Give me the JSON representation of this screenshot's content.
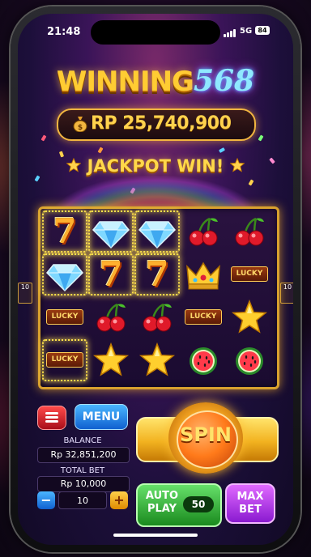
{
  "status": {
    "time": "21:48",
    "network": "5G",
    "battery": "84"
  },
  "header": {
    "logo_word": "WINNING",
    "logo_number": "568"
  },
  "jackpot_balance": "RP 25,740,900",
  "banner": "JACKPOT WIN!",
  "side_labels": {
    "left": "10",
    "right": "10"
  },
  "reels": [
    [
      "seven",
      "diamond",
      "diamond",
      "cherry",
      "cherry"
    ],
    [
      "diamond",
      "seven",
      "seven",
      "crown",
      "lucky"
    ],
    [
      "lucky",
      "cherry",
      "cherry",
      "lucky",
      "star"
    ],
    [
      "lucky",
      "star",
      "star",
      "watermelon",
      "watermelon"
    ]
  ],
  "winning_cells": [
    [
      0,
      0
    ],
    [
      0,
      1
    ],
    [
      0,
      2
    ],
    [
      1,
      0
    ],
    [
      1,
      1
    ],
    [
      1,
      2
    ],
    [
      3,
      0
    ]
  ],
  "lucky_text": "LUCKY",
  "controls": {
    "menu_label": "MENU",
    "balance_label": "BALANCE",
    "balance_value": "Rp 32,851,200",
    "total_bet_label": "TOTAL BET",
    "total_bet_value": "Rp 10,000",
    "bet_minus": "−",
    "bet_plus": "+",
    "bet_step_value": "10",
    "spin_label": "SPIN",
    "autoplay_label_1": "AUTO",
    "autoplay_label_2": "PLAY",
    "autoplay_count": "50",
    "maxbet_label_1": "MAX",
    "maxbet_label_2": "BET"
  },
  "colors": {
    "gold": "#ffd24d",
    "reel_frame": "#d9a12e",
    "menu_blue": "#1060d0",
    "spin_orange": "#ff7a1a",
    "autoplay_green": "#1a8a1e",
    "maxbet_purple": "#8a1ad0"
  }
}
